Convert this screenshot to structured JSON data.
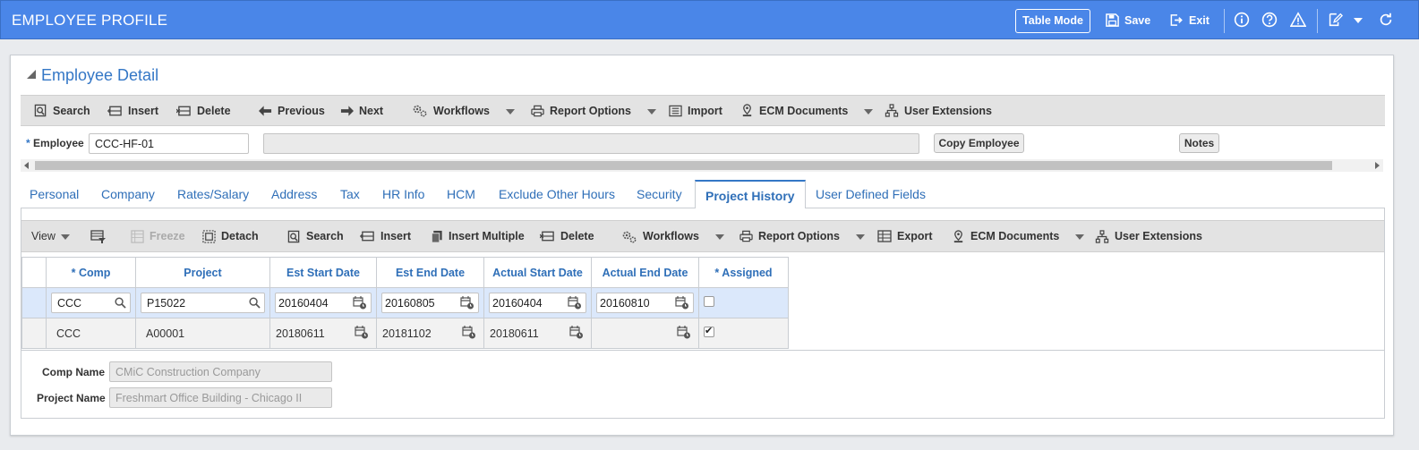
{
  "app": {
    "title": "EMPLOYEE PROFILE",
    "table_mode_label": "Table Mode",
    "save_label": "Save",
    "exit_label": "Exit"
  },
  "panel": {
    "title": "Employee Detail",
    "toolbar": [
      "Search",
      "Insert",
      "Delete",
      "Previous",
      "Next",
      "Workflows",
      "Report Options",
      "Import",
      "ECM Documents",
      "User Extensions"
    ],
    "employee_label": "Employee",
    "employee_required": "*",
    "employee_value": "CCC-HF-01",
    "employee_name_value": "",
    "copy_employee_label": "Copy Employee",
    "notes_label": "Notes"
  },
  "tabs": [
    "Personal",
    "Company",
    "Rates/Salary",
    "Address",
    "Tax",
    "HR Info",
    "HCM",
    "Exclude Other Hours",
    "Security",
    "Project History",
    "User Defined Fields"
  ],
  "active_tab": "Project History",
  "subtoolbar": {
    "view_label": "View",
    "freeze_label": "Freeze",
    "detach_label": "Detach",
    "search_label": "Search",
    "insert_label": "Insert",
    "insert_multiple_label": "Insert Multiple",
    "delete_label": "Delete",
    "workflows_label": "Workflows",
    "report_options_label": "Report Options",
    "export_label": "Export",
    "ecm_documents_label": "ECM Documents",
    "user_extensions_label": "User Extensions"
  },
  "grid": {
    "columns": [
      "* Comp",
      "Project",
      "Est Start Date",
      "Est End Date",
      "Actual Start Date",
      "Actual End Date",
      "* Assigned"
    ],
    "rows": [
      {
        "comp": "CCC",
        "project": "P15022",
        "est_start": "20160404",
        "est_end": "20160805",
        "act_start": "20160404",
        "act_end": "20160810",
        "assigned": false
      },
      {
        "comp": "CCC",
        "project": "A00001",
        "est_start": "20180611",
        "est_end": "20181102",
        "act_start": "20180611",
        "act_end": "",
        "assigned": true
      }
    ]
  },
  "details": {
    "comp_name_label": "Comp Name",
    "comp_name_value": "CMiC Construction Company",
    "project_name_label": "Project Name",
    "project_name_value": "Freshmart Office Building - Chicago II"
  },
  "colors": {
    "header_blue": "#4a86e8",
    "link_blue": "#2f6fb8",
    "selected_row": "#dbe8fb"
  }
}
